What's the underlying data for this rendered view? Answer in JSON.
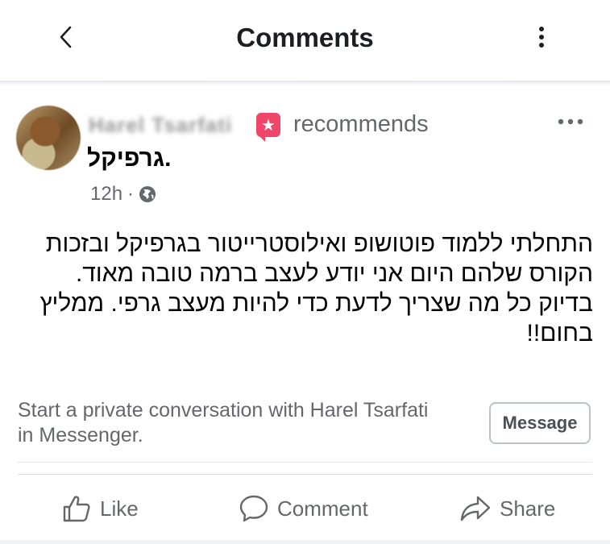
{
  "header": {
    "title": "Comments"
  },
  "post": {
    "author_name": "Harel Tsarfati",
    "action_text": "recommends",
    "page_tag": "גרפיקל.",
    "timestamp": "12h",
    "body": "התחלתי ללמוד פוטושופ ואילוסטרייטור בגרפיקל ובזכות הקורס שלהם היום אני יודע לעצב ברמה טובה מאוד. בדיוק כל מה שצריך לדעת כדי להיות מעצב גרפי. ממליץ בחום!!"
  },
  "private_message": {
    "text": "Start a private conversation with Harel Tsarfati in Messenger.",
    "button_label": "Message"
  },
  "actions": {
    "like": "Like",
    "comment": "Comment",
    "share": "Share"
  },
  "colors": {
    "badge": "#f0466a",
    "secondary_text": "#65676b"
  }
}
